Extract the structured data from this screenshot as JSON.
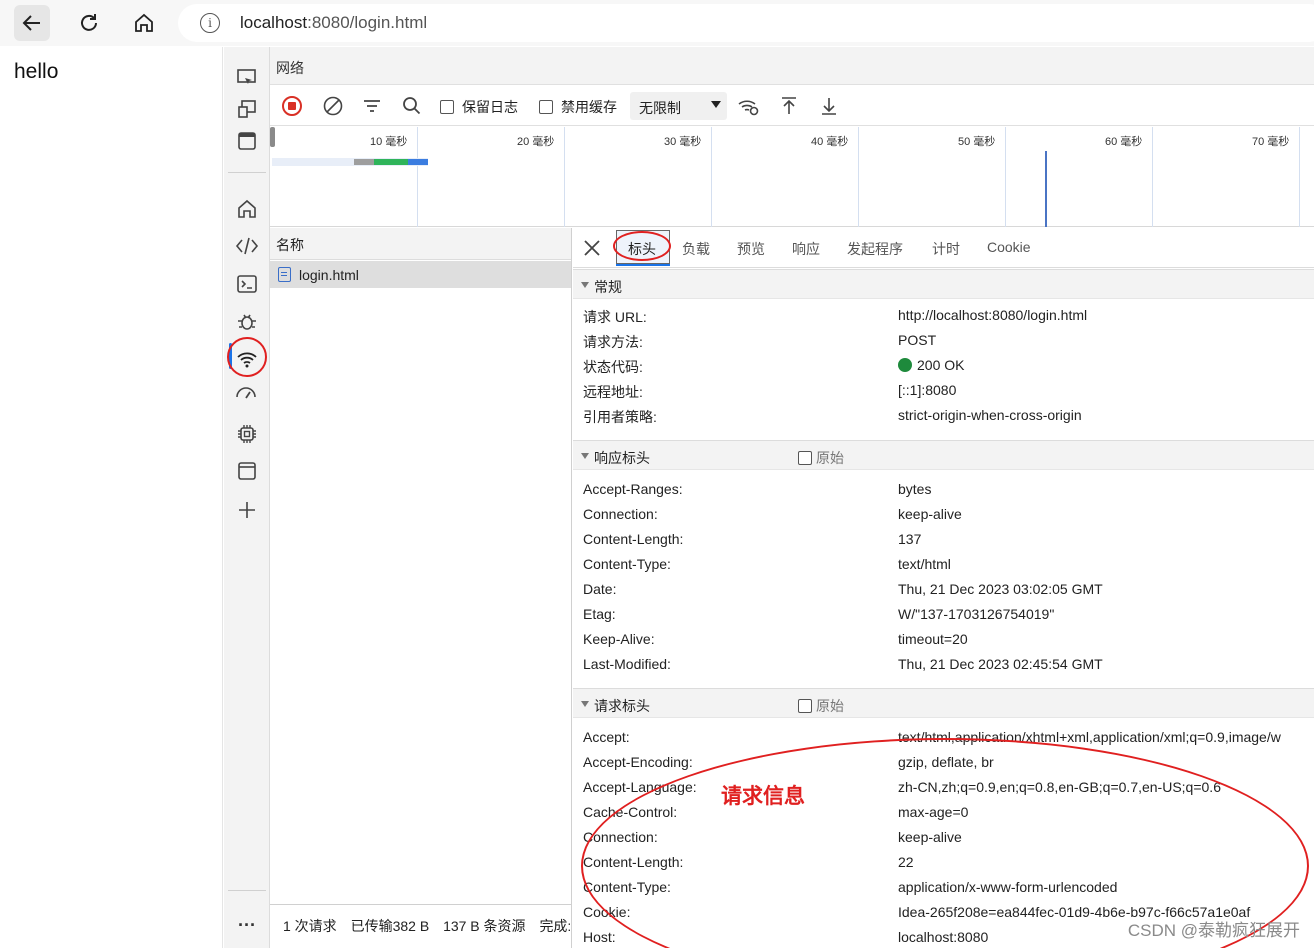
{
  "browser": {
    "url_host": "localhost",
    "url_rest": ":8080/login.html",
    "icons": [
      "back-arrow-icon",
      "reload-icon",
      "home-icon",
      "info-icon"
    ]
  },
  "page": {
    "text": "hello"
  },
  "activity_bar": {
    "icons": [
      "device-emulation-icon",
      "dock-icon",
      "window-icon",
      "welcome-home-icon",
      "elements-code-icon",
      "console-icon",
      "bug-icon",
      "network-wifi-icon",
      "performance-icon",
      "memory-chip-icon",
      "application-icon",
      "add-tool-icon",
      "more-dots-icon"
    ],
    "more_label": "···"
  },
  "panel": {
    "title": "网络",
    "toolbar": {
      "preserve_log": "保留日志",
      "disable_cache": "禁用缓存",
      "throttling": "无限制"
    },
    "timeline": {
      "ticks": [
        "10 毫秒",
        "20 毫秒",
        "30 毫秒",
        "40 毫秒",
        "50 毫秒",
        "60 毫秒",
        "70 毫秒"
      ]
    },
    "request_list": {
      "header": "名称",
      "rows": [
        {
          "name": "login.html"
        }
      ],
      "status": {
        "requests": "1 次请求",
        "transferred": "已传输382 B",
        "resources": "137 B 条资源",
        "finish": "完成:"
      }
    },
    "detail": {
      "tabs": [
        "标头",
        "负载",
        "预览",
        "响应",
        "发起程序",
        "计时",
        "Cookie"
      ],
      "active_tab": "标头",
      "general": {
        "title": "常规",
        "rows": [
          {
            "key": "请求 URL:",
            "value": "http://localhost:8080/login.html"
          },
          {
            "key": "请求方法:",
            "value": "POST"
          },
          {
            "key": "状态代码:",
            "value": "200 OK"
          },
          {
            "key": "远程地址:",
            "value": "[::1]:8080"
          },
          {
            "key": "引用者策略:",
            "value": "strict-origin-when-cross-origin"
          }
        ]
      },
      "response_headers": {
        "title": "响应标头",
        "raw_label": "原始",
        "rows": [
          {
            "key": "Accept-Ranges:",
            "value": "bytes"
          },
          {
            "key": "Connection:",
            "value": "keep-alive"
          },
          {
            "key": "Content-Length:",
            "value": "137"
          },
          {
            "key": "Content-Type:",
            "value": "text/html"
          },
          {
            "key": "Date:",
            "value": "Thu, 21 Dec 2023 03:02:05 GMT"
          },
          {
            "key": "Etag:",
            "value": "W/\"137-1703126754019\""
          },
          {
            "key": "Keep-Alive:",
            "value": "timeout=20"
          },
          {
            "key": "Last-Modified:",
            "value": "Thu, 21 Dec 2023 02:45:54 GMT"
          }
        ]
      },
      "request_headers": {
        "title": "请求标头",
        "raw_label": "原始",
        "rows": [
          {
            "key": "Accept:",
            "value": "text/html,application/xhtml+xml,application/xml;q=0.9,image/w"
          },
          {
            "key": "Accept-Encoding:",
            "value": "gzip, deflate, br"
          },
          {
            "key": "Accept-Language:",
            "value": "zh-CN,zh;q=0.9,en;q=0.8,en-GB;q=0.7,en-US;q=0.6"
          },
          {
            "key": "Cache-Control:",
            "value": "max-age=0"
          },
          {
            "key": "Connection:",
            "value": "keep-alive"
          },
          {
            "key": "Content-Length:",
            "value": "22"
          },
          {
            "key": "Content-Type:",
            "value": "application/x-www-form-urlencoded"
          },
          {
            "key": "Cookie:",
            "value": "Idea-265f208e=ea844fec-01d9-4b6e-b97c-f66c57a1e0af"
          },
          {
            "key": "Host:",
            "value": "localhost:8080"
          }
        ]
      }
    }
  },
  "annotations": {
    "request_info_label": "请求信息",
    "color": "#e02020"
  },
  "watermark": "CSDN @泰勒疯狂展开",
  "colors": {
    "status_ok": "#1e8a3c",
    "accent": "#1a73e8"
  }
}
